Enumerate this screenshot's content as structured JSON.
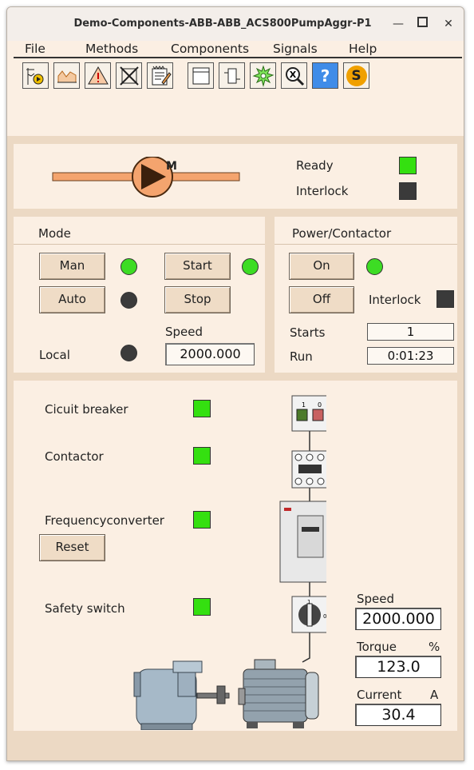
{
  "window": {
    "title": "Demo-Components-ABB-ABB_ACS800PumpAggr-P1"
  },
  "menu": [
    "File",
    "Methods",
    "Components",
    "Signals",
    "Help"
  ],
  "toolbar": [
    {
      "icon": "trend-icon"
    },
    {
      "icon": "area-chart-icon"
    },
    {
      "icon": "warning-icon"
    },
    {
      "icon": "block-icon"
    },
    {
      "icon": "notes-icon"
    },
    {
      "icon": "window-icon"
    },
    {
      "icon": "component-icon"
    },
    {
      "icon": "gear-icon"
    },
    {
      "icon": "crossref-icon"
    },
    {
      "icon": "help-icon",
      "label": "?"
    },
    {
      "icon": "simulate-icon",
      "label": "S"
    }
  ],
  "status": {
    "motor_label": "M",
    "ready_label": "Ready",
    "ready_state": "on",
    "interlock_label": "Interlock",
    "interlock_state": "off"
  },
  "mode": {
    "title": "Mode",
    "man_label": "Man",
    "man_led": "on",
    "auto_label": "Auto",
    "auto_led": "off",
    "start_label": "Start",
    "start_led": "on",
    "stop_label": "Stop",
    "speed_label": "Speed",
    "speed_value": "2000.000",
    "local_label": "Local",
    "local_led": "off"
  },
  "power": {
    "title": "Power/Contactor",
    "on_label": "On",
    "on_led": "on",
    "off_label": "Off",
    "interlock_label": "Interlock",
    "interlock_state": "off",
    "starts_label": "Starts",
    "starts_value": "1",
    "run_label": "Run",
    "run_value": "0:01:23"
  },
  "drive": {
    "circuit_breaker_label": "Cicuit breaker",
    "circuit_breaker_state": "on",
    "contactor_label": "Contactor",
    "contactor_state": "on",
    "freqconv_label": "Frequencyconverter",
    "freqconv_state": "on",
    "reset_label": "Reset",
    "safety_switch_label": "Safety switch",
    "safety_switch_state": "on"
  },
  "measurements": {
    "speed_label": "Speed",
    "speed_value": "2000.000",
    "torque_label": "Torque",
    "torque_unit": "%",
    "torque_value": "123.0",
    "current_label": "Current",
    "current_unit": "A",
    "current_value": "30.4"
  },
  "colors": {
    "led_on": "#3ddc24",
    "led_off": "#3b3b3b",
    "pump_orange": "#f4a46e",
    "background": "#fbefe3",
    "band": "#ecd9c4"
  }
}
